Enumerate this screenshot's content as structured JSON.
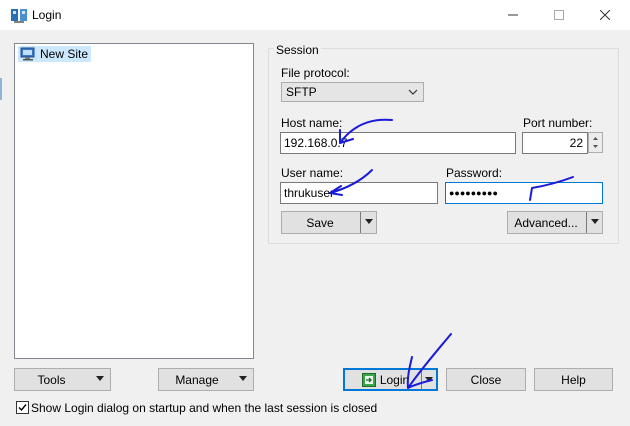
{
  "window": {
    "title": "Login",
    "icons": {
      "app": "winscp-icon",
      "minimize": "minimize-icon",
      "maximize": "maximize-icon",
      "close": "close-icon"
    }
  },
  "sites": {
    "items": [
      {
        "label": "New Site",
        "icon": "computer-icon"
      }
    ]
  },
  "session": {
    "title": "Session",
    "protocol_label": "File protocol:",
    "protocol_value": "SFTP",
    "host_label": "Host name:",
    "host_value": "192.168.0.7",
    "port_label": "Port number:",
    "port_value": "22",
    "user_label": "User name:",
    "user_value": "thrukuser",
    "password_label": "Password:",
    "password_value": "●●●●●●●●●",
    "save_label": "Save",
    "advanced_label": "Advanced..."
  },
  "footer": {
    "tools_label": "Tools",
    "manage_label": "Manage",
    "login_label": "Login",
    "close_label": "Close",
    "help_label": "Help",
    "startup_checkbox_label": "Show Login dialog on startup and when the last session is closed",
    "startup_checked": true
  },
  "annotation_color": "#1a1adb"
}
